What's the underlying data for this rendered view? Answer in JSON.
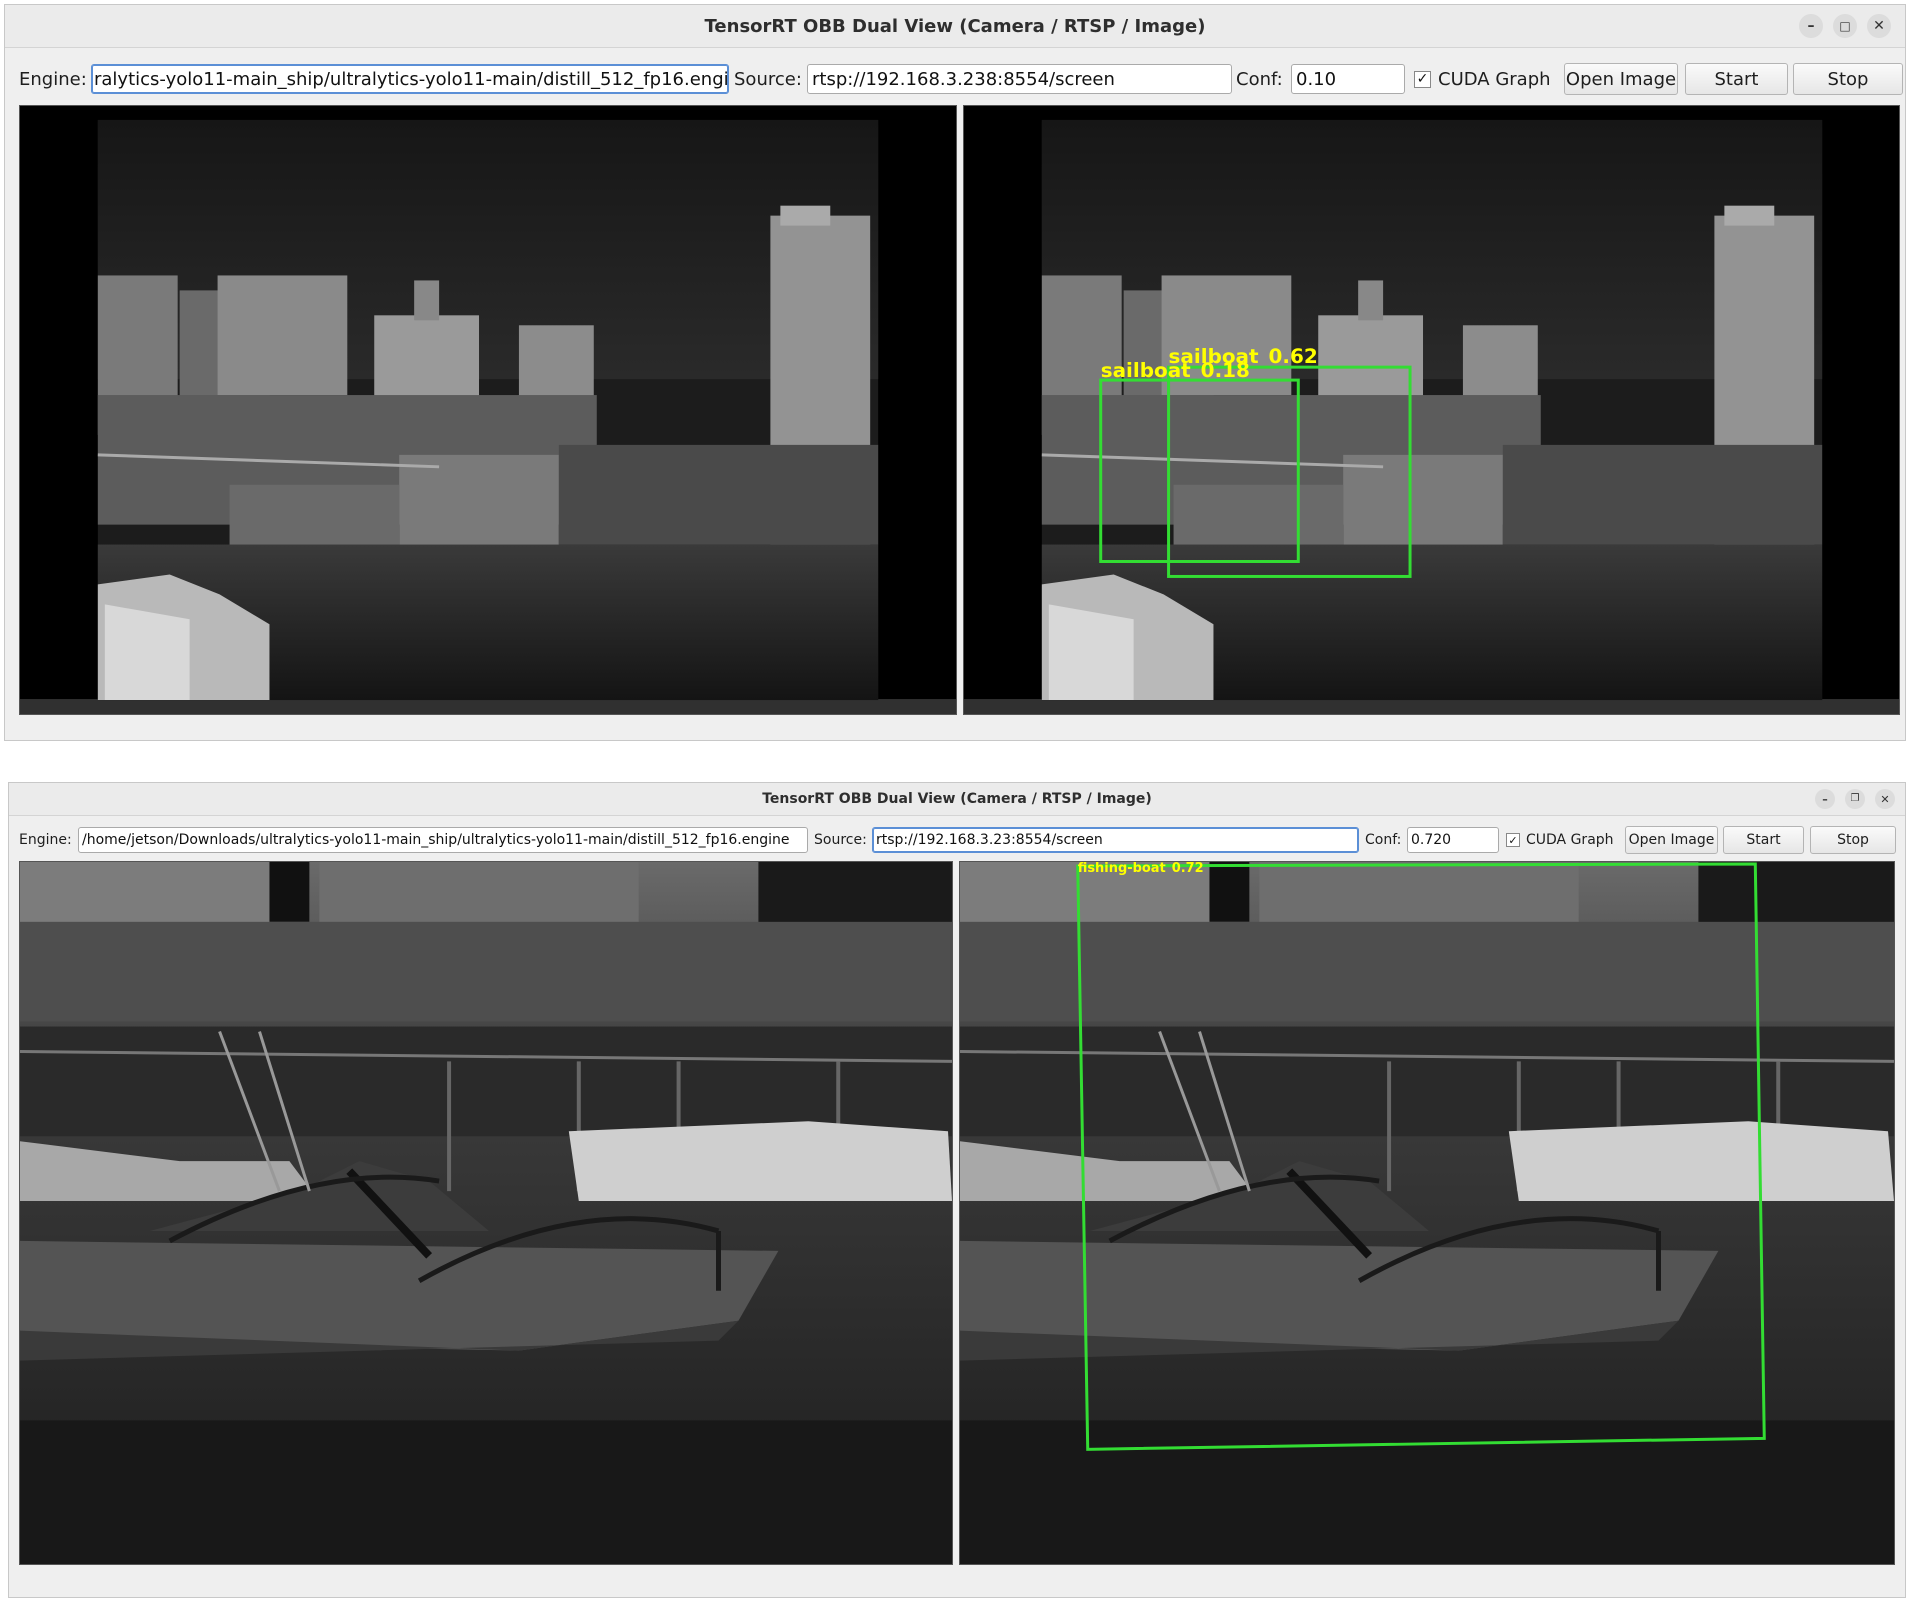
{
  "windows": [
    {
      "title": "TensorRT OBB Dual View (Camera / RTSP / Image)",
      "engine_label": "Engine:",
      "engine_value": "ralytics-yolo11-main_ship/ultralytics-yolo11-main/distill_512_fp16.engine",
      "source_label": "Source:",
      "source_value": "rtsp://192.168.3.238:8554/screen",
      "conf_label": "Conf:",
      "conf_value": "0.10",
      "cuda_graph_label": "CUDA Graph",
      "cuda_graph_checked": "✓",
      "open_image_label": "Open Image",
      "start_label": "Start",
      "stop_label": "Stop",
      "detections": [
        {
          "label": "sailboat",
          "score": "0.62",
          "color": "#ffff00",
          "box_color": "#33dd33"
        },
        {
          "label": "sailboat",
          "score": "0.18",
          "color": "#ffff00",
          "box_color": "#33dd33"
        }
      ]
    },
    {
      "title": "TensorRT OBB Dual View (Camera / RTSP / Image)",
      "engine_label": "Engine:",
      "engine_value": "/home/jetson/Downloads/ultralytics-yolo11-main_ship/ultralytics-yolo11-main/distill_512_fp16.engine",
      "source_label": "Source:",
      "source_value": "rtsp://192.168.3.23:8554/screen",
      "conf_label": "Conf:",
      "conf_value": "0.720",
      "cuda_graph_label": "CUDA Graph",
      "cuda_graph_checked": "✓",
      "open_image_label": "Open Image",
      "start_label": "Start",
      "stop_label": "Stop",
      "detections": [
        {
          "label": "fishing-boat",
          "score": "0.72",
          "color": "#ffff00",
          "box_color": "#33dd33"
        }
      ]
    }
  ],
  "icons": {
    "minimize": "minimize-icon",
    "maximize": "maximize-icon",
    "restore": "restore-icon",
    "close": "close-icon"
  },
  "colors": {
    "window_bg": "#efefef",
    "detection_box": "#33dd33",
    "detection_text": "#ffff00"
  }
}
